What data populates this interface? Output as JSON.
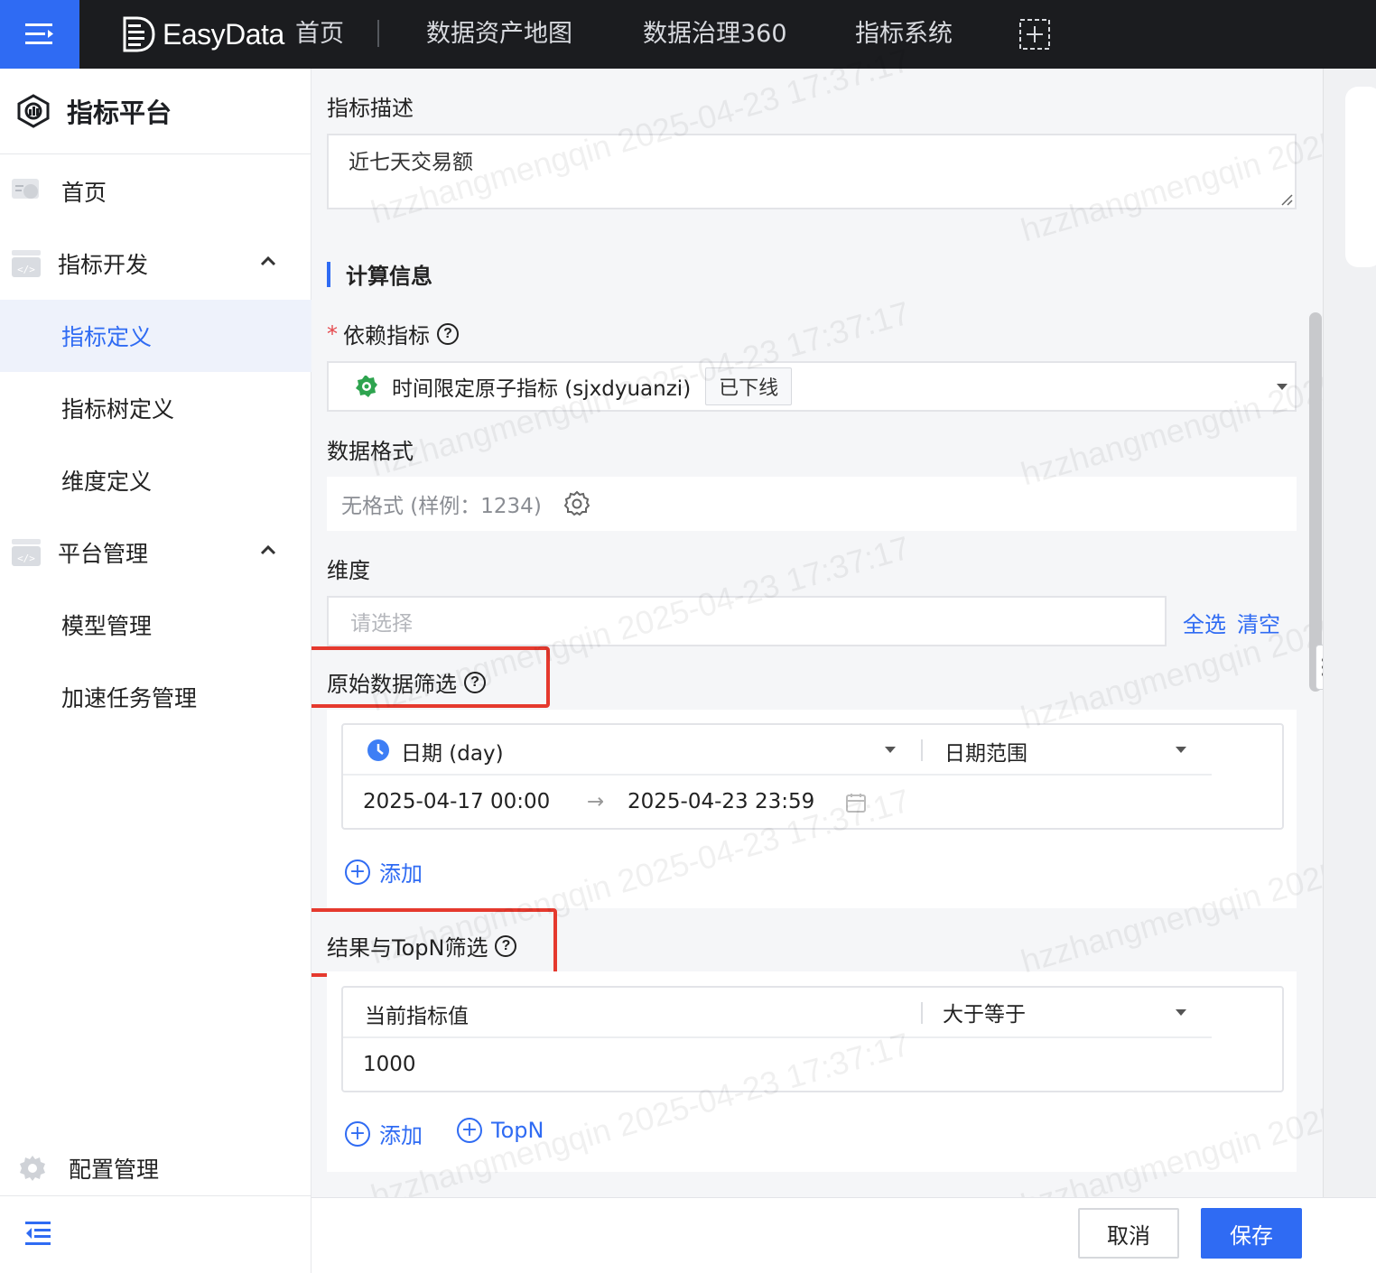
{
  "topbar": {
    "brand": "EasyData",
    "nav": [
      "首页",
      "数据资产地图",
      "数据治理360",
      "指标系统"
    ]
  },
  "sidebar": {
    "title": "指标平台",
    "items": [
      {
        "label": "首页",
        "icon": "dashboard-icon"
      },
      {
        "label": "指标开发",
        "icon": "code-icon",
        "expanded": true
      },
      {
        "label": "指标定义",
        "active": true
      },
      {
        "label": "指标树定义"
      },
      {
        "label": "维度定义"
      },
      {
        "label": "平台管理",
        "icon": "code-icon",
        "expanded": true
      },
      {
        "label": "模型管理"
      },
      {
        "label": "加速任务管理"
      }
    ],
    "config": "配置管理"
  },
  "form": {
    "desc_label": "指标描述",
    "desc_value": "近七天交易额",
    "section_title": "计算信息",
    "dep_label": "依赖指标",
    "dep_value": "时间限定原子指标 (sjxdyuanzi)",
    "dep_tag": "已下线",
    "format_label": "数据格式",
    "format_value": "无格式 (样例：1234)",
    "dim_label": "维度",
    "dim_placeholder": "请选择",
    "select_all": "全选",
    "clear": "清空",
    "raw_filter_label": "原始数据筛选",
    "raw_filter": {
      "field": "日期 (day)",
      "op": "日期范围",
      "start": "2025-04-17 00:00",
      "end": "2025-04-23 23:59"
    },
    "add": "添加",
    "result_filter_label": "结果与TopN筛选",
    "result_filter": {
      "field": "当前指标值",
      "op": "大于等于",
      "value": "1000"
    },
    "add2": "添加",
    "topn": "TopN"
  },
  "footer": {
    "cancel": "取消",
    "save": "保存"
  },
  "watermark": {
    "user": "hzzhangmengqin",
    "time": "2025-04-23 17:37:17"
  },
  "colors": {
    "accent": "#2f6bf3",
    "highlight": "#e5392e",
    "topbar": "#1b1c1f"
  }
}
